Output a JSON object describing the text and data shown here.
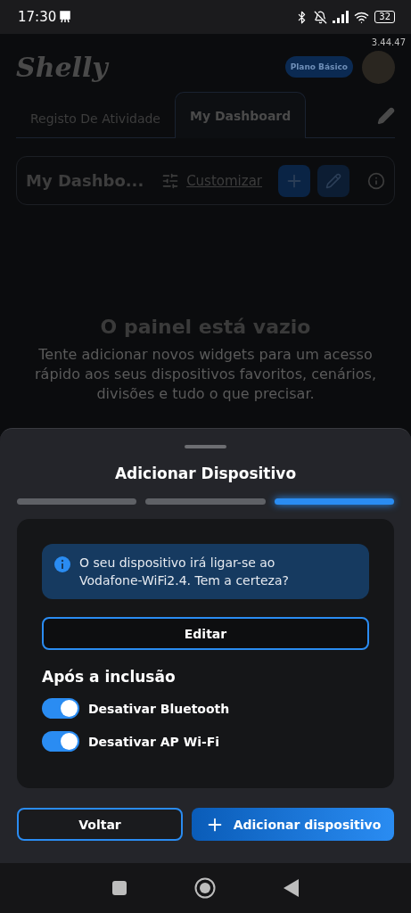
{
  "status_bar": {
    "time": "17:30",
    "battery": "32"
  },
  "app": {
    "version": "3.44.47",
    "logo": "Shelly",
    "plan_badge": "Plano Básico",
    "tabs": [
      {
        "label": "Registo De Atividade",
        "selected": false
      },
      {
        "label": "My Dashboard",
        "selected": true
      }
    ],
    "dashboard": {
      "name": "My Dashbo...",
      "customize_link": "Customizar"
    },
    "empty_state": {
      "title": "O painel está vazio",
      "description": "Tente adicionar novos widgets para um acesso rápido aos seus dispositivos favoritos, cenários, divisões e tudo o que precisar."
    }
  },
  "sheet": {
    "title": "Adicionar Dispositivo",
    "steps": [
      {
        "active": false
      },
      {
        "active": false
      },
      {
        "active": true
      }
    ],
    "info": "O seu dispositivo irá ligar-se ao Vodafone-WiFi2.4. Tem a certeza?",
    "edit_button": "Editar",
    "section_title": "Após a inclusão",
    "toggles": [
      {
        "label": "Desativar Bluetooth",
        "on": true
      },
      {
        "label": "Desativar AP Wi-Fi",
        "on": true
      }
    ],
    "back_button": "Voltar",
    "add_button": "Adicionar dispositivo"
  }
}
